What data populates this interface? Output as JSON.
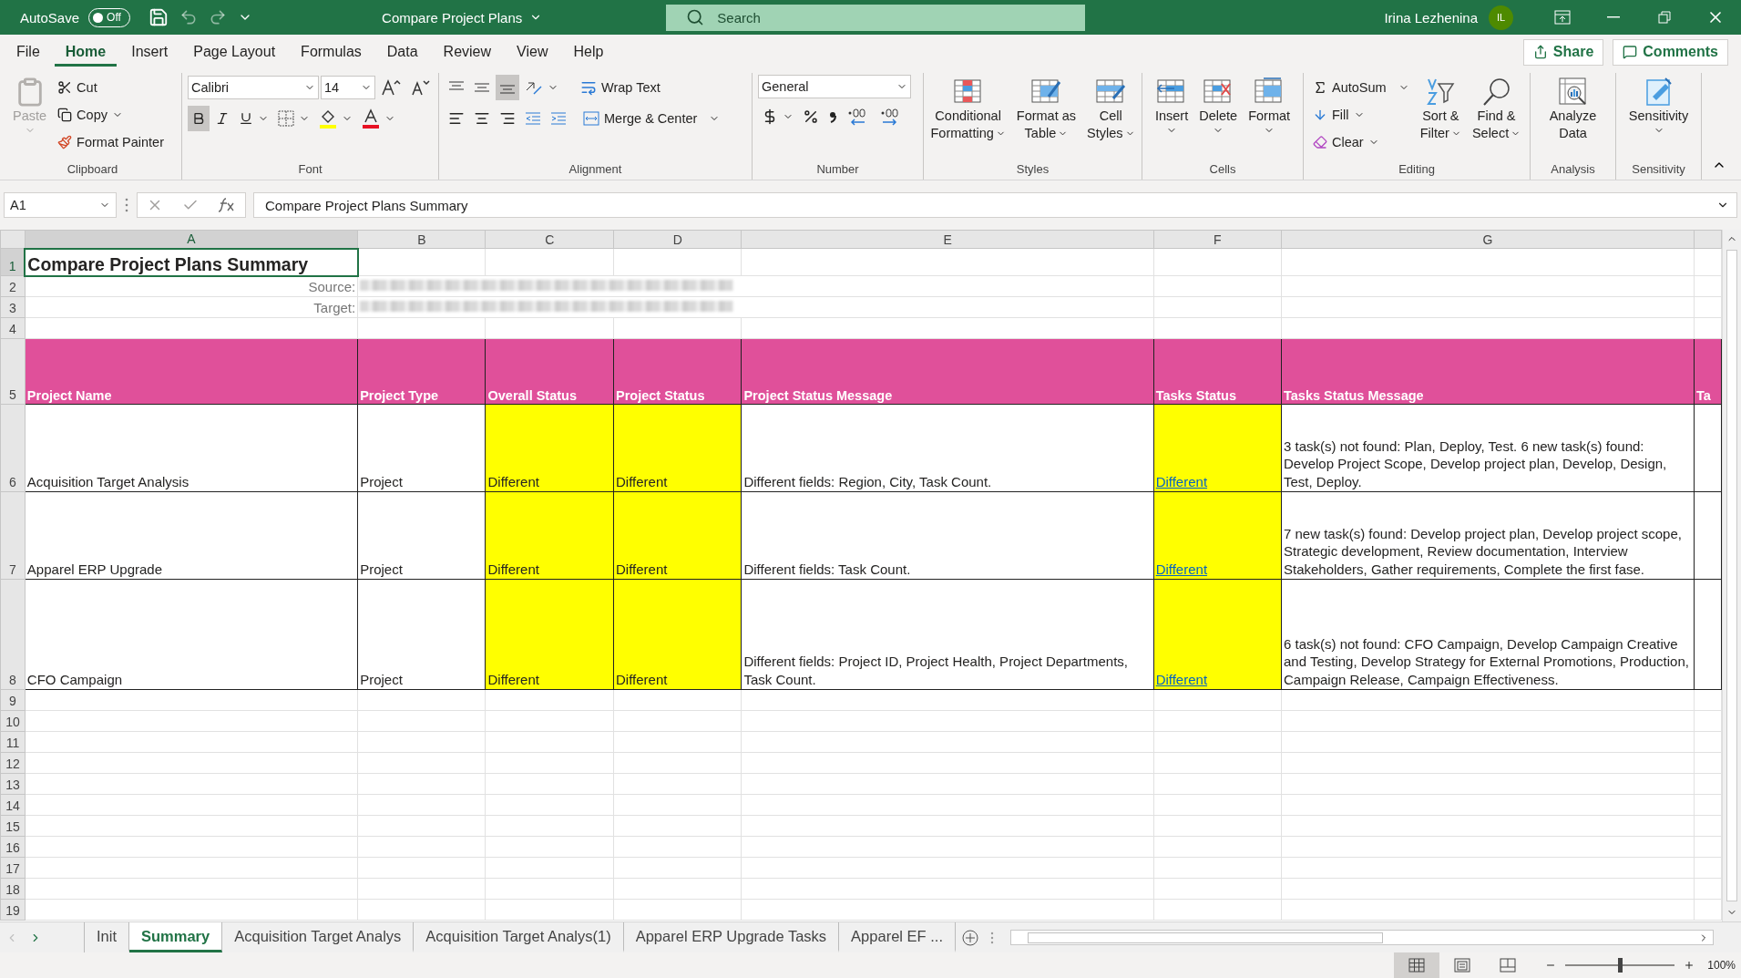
{
  "title_bar": {
    "autosave_label": "AutoSave",
    "autosave": {
      "on": false,
      "label": "Off"
    },
    "title": "Compare Project Plans",
    "search_placeholder": "Search",
    "user_name": "Irina Lezhenina",
    "user_initials": "IL"
  },
  "ribbon_tabs": [
    {
      "label": "File",
      "selected": false
    },
    {
      "label": "Home",
      "selected": true
    },
    {
      "label": "Insert",
      "selected": false
    },
    {
      "label": "Page Layout",
      "selected": false
    },
    {
      "label": "Formulas",
      "selected": false
    },
    {
      "label": "Data",
      "selected": false
    },
    {
      "label": "Review",
      "selected": false
    },
    {
      "label": "View",
      "selected": false
    },
    {
      "label": "Help",
      "selected": false
    }
  ],
  "share": "Share",
  "comments": "Comments",
  "ribbon": {
    "clipboard": {
      "label": "Clipboard",
      "paste": {
        "label": "Paste",
        "disabled": true
      },
      "cut": "Cut",
      "copy": "Copy",
      "format_painter": "Format Painter"
    },
    "font": {
      "label": "Font",
      "font_name": "Calibri",
      "font_size": "14",
      "bold": true
    },
    "alignment": {
      "label": "Alignment",
      "bottom_align": true,
      "wrap_text": "Wrap Text",
      "merge_center": "Merge & Center"
    },
    "number": {
      "label": "Number",
      "format": "General"
    },
    "styles": {
      "label": "Styles",
      "buttons": [
        {
          "kind": "conditional",
          "lines": [
            "Conditional",
            "Formatting"
          ]
        },
        {
          "kind": "table",
          "lines": [
            "Format as",
            "Table"
          ]
        },
        {
          "kind": "cellstyles",
          "lines": [
            "Cell",
            "Styles"
          ]
        }
      ]
    },
    "cells": {
      "label": "Cells",
      "buttons": [
        {
          "kind": "insert",
          "lines": [
            "Insert"
          ]
        },
        {
          "kind": "delete",
          "lines": [
            "Delete"
          ]
        },
        {
          "kind": "format",
          "lines": [
            "Format"
          ]
        }
      ]
    },
    "editing": {
      "label": "Editing",
      "autosum": "AutoSum",
      "fill": "Fill",
      "clear": "Clear",
      "buttons": [
        {
          "kind": "sort",
          "lines": [
            "Sort &",
            "Filter"
          ]
        },
        {
          "kind": "find",
          "lines": [
            "Find &",
            "Select"
          ]
        }
      ]
    },
    "analysis": {
      "label": "Analysis",
      "buttons": [
        {
          "kind": "analyze",
          "lines": [
            "Analyze",
            "Data"
          ]
        }
      ]
    },
    "sensitivity": {
      "label": "Sensitivity",
      "buttons": [
        {
          "kind": "sensitivity",
          "lines": [
            "Sensitivity"
          ]
        }
      ]
    }
  },
  "formula_bar": {
    "name_box": "A1",
    "formula": "Compare Project Plans Summary"
  },
  "sheet": {
    "columns": [
      {
        "label": "A",
        "selected": true
      },
      {
        "label": "B",
        "selected": false
      },
      {
        "label": "C",
        "selected": false
      },
      {
        "label": "D",
        "selected": false
      },
      {
        "label": "E",
        "selected": false
      },
      {
        "label": "F",
        "selected": false
      },
      {
        "label": "G",
        "selected": false
      }
    ],
    "row_headers": [
      {
        "label": "1",
        "selected": true
      },
      {
        "label": "2",
        "selected": false
      },
      {
        "label": "3",
        "selected": false
      },
      {
        "label": "4",
        "selected": false
      },
      {
        "label": "5",
        "selected": false
      },
      {
        "label": "6",
        "selected": false
      },
      {
        "label": "7",
        "selected": false
      },
      {
        "label": "8",
        "selected": false
      },
      {
        "label": "9",
        "selected": false
      },
      {
        "label": "10",
        "selected": false
      },
      {
        "label": "11",
        "selected": false
      },
      {
        "label": "12",
        "selected": false
      },
      {
        "label": "13",
        "selected": false
      },
      {
        "label": "14",
        "selected": false
      },
      {
        "label": "15",
        "selected": false
      },
      {
        "label": "16",
        "selected": false
      },
      {
        "label": "17",
        "selected": false
      },
      {
        "label": "18",
        "selected": false
      },
      {
        "label": "19",
        "selected": false
      }
    ],
    "title": "Compare Project Plans Summary",
    "source_label": "Source:",
    "target_label": "Target:",
    "header": [
      "Project Name",
      "Project Type",
      "Overall Status",
      "Project Status",
      "Project Status Message",
      "Tasks Status",
      "Tasks Status Message",
      "Ta"
    ],
    "rows": [
      [
        {
          "text": "Acquisition Target Analysis",
          "highlight": false,
          "link": false
        },
        {
          "text": "Project",
          "highlight": false,
          "link": false
        },
        {
          "text": "Different",
          "highlight": true,
          "link": false
        },
        {
          "text": "Different",
          "highlight": true,
          "link": false
        },
        {
          "text": "Different fields: Region, City, Task Count.",
          "highlight": false,
          "link": false
        },
        {
          "text": "Different",
          "highlight": true,
          "link": true
        },
        {
          "text": "3 task(s) not found: Plan, Deploy, Test. 6 new task(s) found: Develop Project Scope, Develop project plan, Develop, Design, Test, Deploy.",
          "highlight": false,
          "link": false
        }
      ],
      [
        {
          "text": "Apparel ERP Upgrade",
          "highlight": false,
          "link": false
        },
        {
          "text": "Project",
          "highlight": false,
          "link": false
        },
        {
          "text": "Different",
          "highlight": true,
          "link": false
        },
        {
          "text": "Different",
          "highlight": true,
          "link": false
        },
        {
          "text": "Different fields: Task Count.",
          "highlight": false,
          "link": false
        },
        {
          "text": "Different",
          "highlight": true,
          "link": true
        },
        {
          "text": "7 new task(s) found: Develop project plan, Develop project scope, Strategic development, Review documentation, Interview Stakeholders, Gather requirements, Complete the first fase.",
          "highlight": false,
          "link": false
        }
      ],
      [
        {
          "text": "CFO Campaign",
          "highlight": false,
          "link": false
        },
        {
          "text": "Project",
          "highlight": false,
          "link": false
        },
        {
          "text": "Different",
          "highlight": true,
          "link": false
        },
        {
          "text": "Different",
          "highlight": true,
          "link": false
        },
        {
          "text": "Different fields: Project ID, Project Health, Project Departments, Task Count.",
          "highlight": false,
          "link": false
        },
        {
          "text": "Different",
          "highlight": true,
          "link": true
        },
        {
          "text": "6 task(s) not found: CFO Campaign, Develop Campaign Creative and Testing, Develop Strategy for External Promotions, Production, Campaign Release, Campaign Effectiveness.",
          "highlight": false,
          "link": false
        }
      ]
    ]
  },
  "sheet_tabs": [
    {
      "label": "Init",
      "selected": false
    },
    {
      "label": "Summary",
      "selected": true
    },
    {
      "label": "Acquisition Target Analys",
      "selected": false
    },
    {
      "label": "Acquisition Target Analys(1)",
      "selected": false
    },
    {
      "label": "Apparel ERP Upgrade Tasks",
      "selected": false
    },
    {
      "label": "Apparel EF ...",
      "selected": false
    }
  ],
  "status_bar": {
    "views": [
      {
        "kind": "normal",
        "selected": true
      },
      {
        "kind": "page_layout",
        "selected": false
      },
      {
        "kind": "page_break",
        "selected": false
      }
    ],
    "zoom": {
      "level": 0.5,
      "label": "100%"
    }
  }
}
